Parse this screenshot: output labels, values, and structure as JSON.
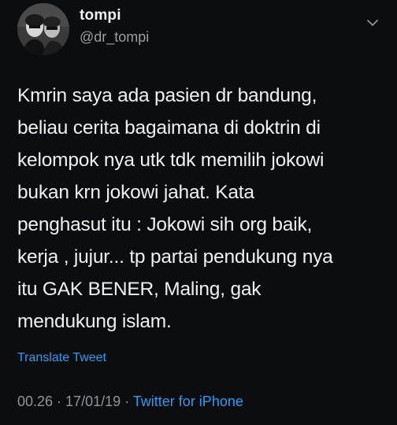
{
  "user": {
    "name": "tompi",
    "handle": "@dr_tompi"
  },
  "tweet": {
    "text": "Kmrin saya ada pasien dr bandung,\nbeliau cerita bagaimana di doktrin di\nkelompok nya utk tdk memilih jokowi\nbukan krn jokowi jahat. Kata\npenghasut itu : Jokowi sih org baik,\nkerja , jujur... tp partai pendukung nya\nitu GAK BENER, Maling, gak\nmendukung islam.",
    "translate_label": "Translate Tweet",
    "time": "00.26",
    "separator": " · ",
    "date": "17/01/19",
    "source": "Twitter for iPhone"
  },
  "icons": {
    "avatar": "profile-photo",
    "menu": "chevron-down-icon"
  },
  "colors": {
    "background": "#0b0d0f",
    "link": "#2d9bf0",
    "secondary_text": "#8f959b"
  }
}
